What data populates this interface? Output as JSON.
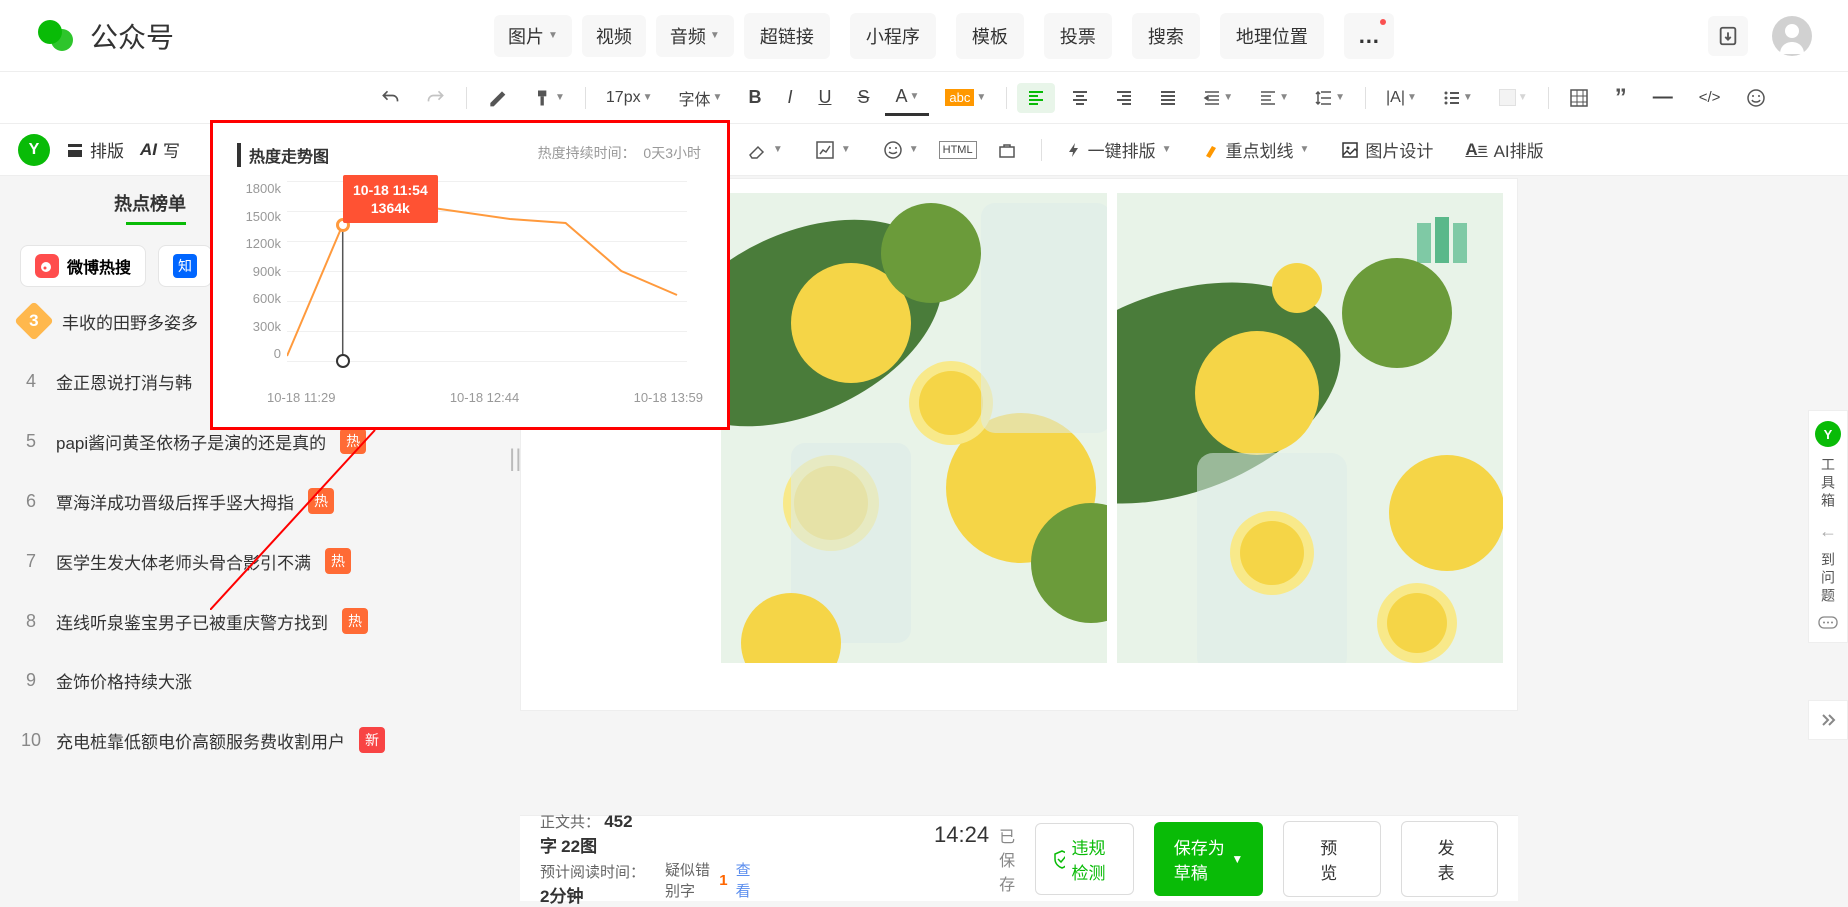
{
  "header": {
    "title": "公众号",
    "media": [
      "图片",
      "视频",
      "音频"
    ],
    "nav": [
      "超链接",
      "小程序",
      "模板",
      "投票",
      "搜索",
      "地理位置"
    ]
  },
  "toolbar": {
    "fontsize": "17px",
    "font_label": "字体",
    "onekey": "一键排版",
    "highlight": "重点划线",
    "img_design": "图片设计",
    "ai_layout": "AI排版",
    "layout": "排版"
  },
  "sidebar": {
    "title": "热点榜单",
    "tabs": [
      {
        "label": "微博热搜",
        "icon": "weibo",
        "active": true
      },
      {
        "label": "",
        "icon": "zhihu",
        "active": false
      }
    ],
    "items": [
      {
        "rank": "3",
        "rank_style": "hex",
        "title": "丰收的田野多姿多",
        "badge": null
      },
      {
        "rank": "4",
        "title": "金正恩说打消与韩",
        "badge": null
      },
      {
        "rank": "5",
        "title": "papi酱问黄圣依杨子是演的还是真的",
        "badge": "热"
      },
      {
        "rank": "6",
        "title": "覃海洋成功晋级后挥手竖大拇指",
        "badge": "热"
      },
      {
        "rank": "7",
        "title": "医学生发大体老师头骨合影引不满",
        "badge": "热"
      },
      {
        "rank": "8",
        "title": "连线听泉鉴宝男子已被重庆警方找到",
        "badge": "热"
      },
      {
        "rank": "9",
        "title": "金饰价格持续大涨",
        "badge": null
      },
      {
        "rank": "10",
        "title": "充电桩靠低额电价高额服务费收割用户",
        "badge": "新"
      }
    ]
  },
  "popover": {
    "title": "热度走势图",
    "meta_label": "热度持续时间：",
    "meta_value": "0天3小时",
    "tooltip_time": "10-18 11:54",
    "tooltip_value": "1364k"
  },
  "chart_data": {
    "type": "line",
    "title": "热度走势图",
    "xlabel": "",
    "ylabel": "",
    "ylim": [
      0,
      1800000
    ],
    "y_ticks": [
      "1800k",
      "1500k",
      "1200k",
      "900k",
      "600k",
      "300k",
      "0"
    ],
    "x_ticks": [
      "10-18 11:29",
      "10-18 12:44",
      "10-18 13:59"
    ],
    "x": [
      "10-18 11:29",
      "10-18 11:54",
      "10-18 12:19",
      "10-18 12:44",
      "10-18 13:09",
      "10-18 13:34",
      "10-18 13:59",
      "10-18 14:24"
    ],
    "values": [
      50000,
      1364000,
      1580000,
      1500000,
      1420000,
      1380000,
      900000,
      660000
    ],
    "highlight_index": 1,
    "highlight_label": "10-18 11:54",
    "highlight_value": "1364k"
  },
  "status": {
    "body_label": "正文共：",
    "body_words": "452字",
    "body_imgs": "22图",
    "read_label": "预计阅读时间：",
    "read_value": "2分钟",
    "err_label": "疑似错别字",
    "err_count": "1",
    "view": "查看",
    "time": "14:24",
    "saved": "已保存",
    "rule_check": "违规检测",
    "save_draft": "保存为草稿",
    "preview": "预览",
    "publish": "发表"
  },
  "dock": {
    "label1": "工具箱",
    "label2": "到问题"
  },
  "icons": {
    "ai_write": "写"
  }
}
